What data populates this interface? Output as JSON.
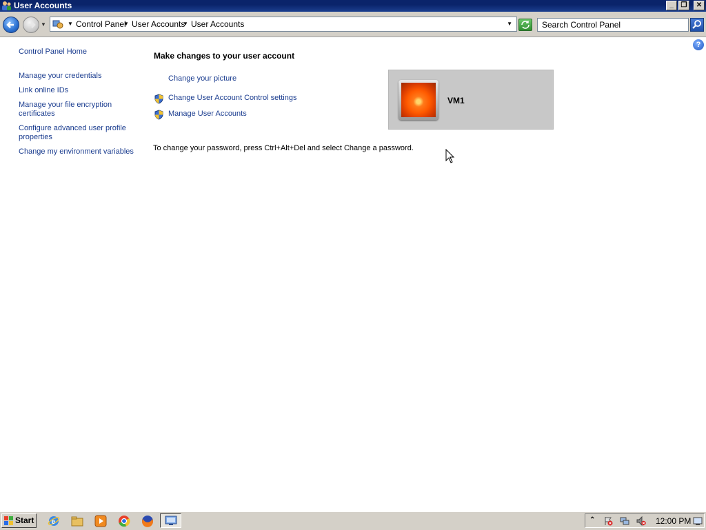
{
  "window": {
    "title": "User Accounts",
    "minimize": "minimize-icon",
    "maximize": "restore-icon",
    "close": "close-icon"
  },
  "address_bar": {
    "breadcrumbs": [
      "Control Panel",
      "User Accounts",
      "User Accounts"
    ],
    "search_placeholder": "Search Control Panel"
  },
  "left_nav": {
    "home": "Control Panel Home",
    "links": [
      "Manage your credentials",
      "Link online IDs",
      "Manage your file encryption certificates",
      "Configure advanced user profile properties",
      "Change my environment variables"
    ]
  },
  "main": {
    "heading": "Make changes to your user account",
    "tasks": [
      {
        "label": "Change your picture",
        "icon": ""
      },
      {
        "label": "Change User Account Control settings",
        "icon": "uac-shield-icon"
      },
      {
        "label": "Manage User Accounts",
        "icon": "uac-shield-icon"
      }
    ],
    "password_note": "To change your password, press Ctrl+Alt+Del and select Change a password."
  },
  "user_tile": {
    "username": "VM1",
    "picture": "flower-picture"
  },
  "taskbar": {
    "start_label": "Start",
    "quick_launch": [
      "internet-explorer-icon",
      "windows-explorer-icon",
      "media-player-icon",
      "chrome-icon",
      "firefox-icon"
    ],
    "active_task": "control-panel-icon",
    "clock": "12:00 PM"
  }
}
